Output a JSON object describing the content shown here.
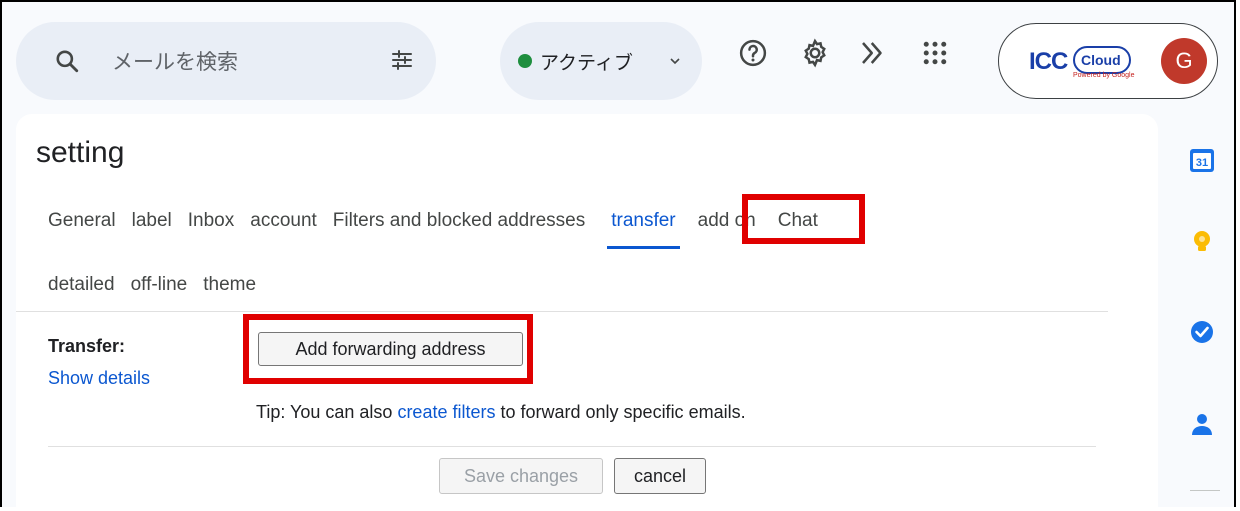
{
  "search": {
    "placeholder": "メールを検索"
  },
  "status": {
    "label": "アクティブ",
    "color": "#1e8e3e"
  },
  "account": {
    "logo_main": "ICC",
    "logo_cloud": "Cloud",
    "logo_powered": "Powered by Google",
    "avatar_letter": "G",
    "avatar_color": "#c0392b"
  },
  "settings": {
    "title": "setting",
    "tabs_row1": [
      "General",
      "label",
      "Inbox",
      "account",
      "Filters and blocked addresses",
      "transfer",
      "add on",
      "Chat"
    ],
    "tabs_row2": [
      "detailed",
      "off-line",
      "theme"
    ],
    "active_tab": "transfer",
    "transfer_label": "Transfer:",
    "show_details": "Show details",
    "add_forwarding_button": "Add forwarding address",
    "tip_prefix": "Tip: You can also ",
    "tip_link": "create filters",
    "tip_suffix": " to forward only specific emails.",
    "save_button": "Save changes",
    "cancel_button": "cancel"
  },
  "side_panel": {
    "calendar_number": "31",
    "icons": [
      "calendar-icon",
      "keep-icon",
      "tasks-icon",
      "contacts-icon"
    ]
  },
  "colors": {
    "accent": "#0b57d0",
    "highlight": "#e00000"
  }
}
